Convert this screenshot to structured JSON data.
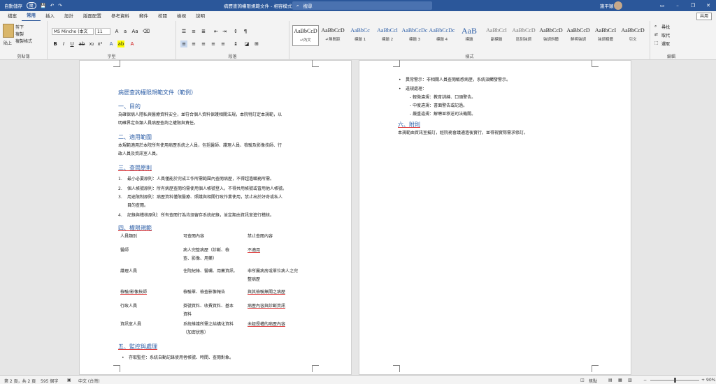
{
  "titlebar": {
    "autosave": "自動儲存",
    "autosave_state": "關",
    "filename": "病歷查詢權限規範文件 - 相容模式 - 已儲存到 此電腦",
    "search_placeholder": "搜尋",
    "user": "施平穎"
  },
  "tabs": [
    "檔案",
    "常用",
    "插入",
    "設計",
    "版面配置",
    "參考資料",
    "郵件",
    "校閱",
    "檢視",
    "說明"
  ],
  "active_tab": "常用",
  "share": "共用",
  "ribbon": {
    "paste": "貼上",
    "cut": "剪下",
    "copy": "複製",
    "format_painter": "複製格式",
    "clipboard_label": "剪貼簿",
    "font_name": "MS Mincho (本文",
    "font_size": "11",
    "font_label": "字型",
    "paragraph_label": "段落",
    "styles_label": "樣式",
    "editing_label": "編輯",
    "styles": [
      {
        "sample": "AaBbCcD",
        "name": "↵內文"
      },
      {
        "sample": "AaBbCcD",
        "name": "↵無間距"
      },
      {
        "sample": "AaBbCc",
        "name": "標題 1"
      },
      {
        "sample": "AaBbCcl",
        "name": "標題 2"
      },
      {
        "sample": "AaBbCcDc",
        "name": "標題 3"
      },
      {
        "sample": "AaBbCcDc",
        "name": "標題 4"
      },
      {
        "sample": "AaB",
        "name": "標題"
      },
      {
        "sample": "AaBbCcl",
        "name": "副標題"
      },
      {
        "sample": "AaBbCcD",
        "name": "區別強調"
      },
      {
        "sample": "AaBbCcD",
        "name": "強調斜體"
      },
      {
        "sample": "AaBbCcD",
        "name": "鮮明強調"
      },
      {
        "sample": "AaBbCcI",
        "name": "強調粗體"
      },
      {
        "sample": "AaBbCcD",
        "name": "引文"
      }
    ],
    "find": "尋找",
    "replace": "取代",
    "select": "選取"
  },
  "doc": {
    "title": "病歷查詢權限規範文件（範例）",
    "s1_title": "一、目的",
    "s1_body": [
      "為確保病人隱私與醫療資料安全，並符合個人資料保護相關法規，本院特訂定本規範，以",
      "明確界定各類人員病歷查詢之權限與責任。"
    ],
    "s2_title": "二、適用範圍",
    "s2_body": [
      "本規範適用於本院所有使用病歷系統之人員，包括醫師、護理人員、檢驗及影像技師、行",
      "政人員及資訊室人員。"
    ],
    "s3_title": "三、查閱原則",
    "s3_items": [
      "最小必要原則：人員僅能於完成工作所需範圍內查閱病歷，不得超過職務所需。",
      "個人帳號原則：所有病歷查閱均需使用個人帳號登入，不得共用帳號或冒用他人帳號。",
      "用途限制原則：病歷資料僅限醫療、照護與相關行政作業使用，禁止出於好奇或私人",
      "記錄與稽核原則：所有查閱行為均須留存系統紀錄，並定期由資訊室進行稽核。"
    ],
    "s3_item3_cont": "目的查閱。",
    "s4_title": "四、權限規範",
    "table_head": [
      "人員類別",
      "可查閱內容",
      "禁止查閱內容"
    ],
    "table_rows": [
      [
        "醫師",
        "病人完整病歷（診斷、檢",
        "不適用"
      ],
      [
        "護理人員",
        "住院紀錄、醫囑、用藥資訊、",
        "非所屬病房或單位病人之完"
      ],
      [
        "檢驗/影像技師",
        "檢驗單、檢查影像報告",
        "與其檢驗無關之病歷"
      ],
      [
        "行政人員",
        "掛號資料、收費資料、基本",
        "病歷內容與診斷資訊"
      ],
      [
        "資訊室人員",
        "系統維護所需之結構化資料",
        "未經授權的病歷內容"
      ]
    ],
    "table_cont": {
      "r1b": "查、影像、用藥）",
      "r2c": "整病歷",
      "r4b": "資料",
      "r5b": "（加密狀態）"
    },
    "s5_title": "五、監控與處理",
    "s5_item": "存取監控：系統自動記錄使用者帳號、時間、查閱對象。",
    "p2_items": [
      "異常警示：非相關人員查閱敏感病歷，系統須觸發警示。",
      "違規處理："
    ],
    "p2_sub": [
      "- 輕微違規：教育訓練、口頭警告。",
      "- 中度違規：書面警告或記過。",
      "- 嚴重違規：解聘並移送司法機關。"
    ],
    "s6_title": "六、附則",
    "s6_body": "本規範由資訊室擬訂，經院務會議通過後實行，並得視實際需求修訂。"
  },
  "status": {
    "page": "第 2 頁，共 2 頁",
    "words": "595 個字",
    "lang": "中文 (台灣)",
    "focus": "焦點",
    "zoom": "90%"
  }
}
